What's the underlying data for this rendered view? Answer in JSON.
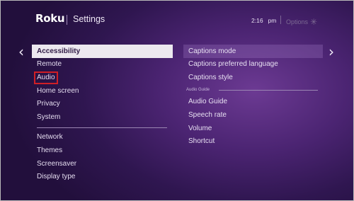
{
  "header": {
    "logo": "Roku",
    "title": "Settings",
    "time": "2:16",
    "ampm": "pm",
    "options_label": "Options",
    "options_icon": "asterisk-icon"
  },
  "nav": {
    "left_arrow": "‹",
    "right_arrow": "›"
  },
  "menu": {
    "items": [
      {
        "label": "Accessibility",
        "state": "selected"
      },
      {
        "label": "Remote"
      },
      {
        "label": "Audio",
        "state": "highlighted-red-box"
      },
      {
        "label": "Home screen"
      },
      {
        "label": "Privacy"
      },
      {
        "label": "System"
      },
      {
        "label": "Network"
      },
      {
        "label": "Themes"
      },
      {
        "label": "Screensaver"
      },
      {
        "label": "Display type"
      }
    ]
  },
  "submenu": {
    "captions": [
      {
        "label": "Captions mode",
        "state": "focused"
      },
      {
        "label": "Captions preferred language"
      },
      {
        "label": "Captions style"
      }
    ],
    "audio_guide_header": "Audio Guide",
    "audio_guide": [
      {
        "label": "Audio Guide"
      },
      {
        "label": "Speech rate"
      },
      {
        "label": "Volume"
      },
      {
        "label": "Shortcut"
      }
    ]
  },
  "colors": {
    "background": "#4b2472",
    "selected_bg": "#ece8ef",
    "highlight_border": "#d01f26"
  }
}
